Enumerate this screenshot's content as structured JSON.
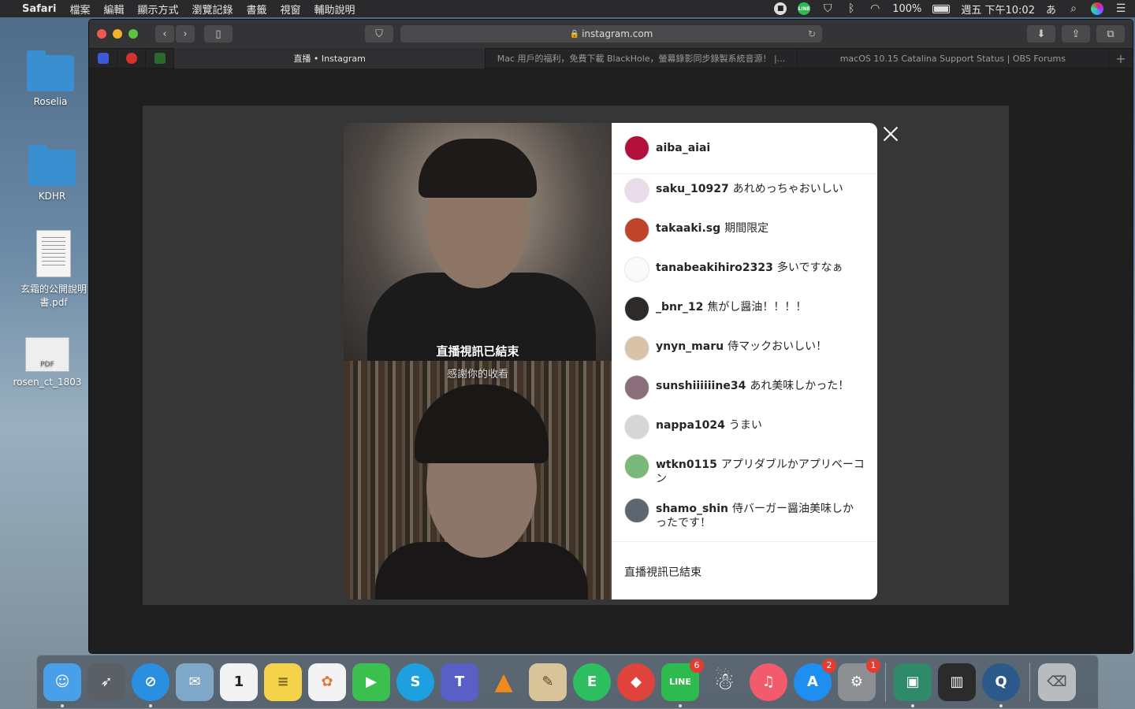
{
  "menubar": {
    "app": "Safari",
    "items": [
      "檔案",
      "編輯",
      "顯示方式",
      "瀏覽記錄",
      "書籤",
      "視窗",
      "輔助說明"
    ],
    "battery": "100%",
    "clock": "週五 下午10:02",
    "input_method": "あ",
    "line_label": "LINE"
  },
  "desktop": {
    "icons": [
      {
        "label": "Roselia"
      },
      {
        "label": "KDHR"
      },
      {
        "label": "玄霜的公開說明書.pdf"
      },
      {
        "label": "rosen_ct_1803"
      }
    ],
    "pdf_tag": "PDF"
  },
  "safari": {
    "url": "instagram.com",
    "tabs": [
      {
        "title": "直播 • Instagram",
        "active": true
      },
      {
        "title": "Mac 用戶的福利，免費下載 BlackHole，螢幕錄影同步錄製系統音源！ |...",
        "active": false
      },
      {
        "title": "macOS 10.15 Catalina Support Status | OBS Forums",
        "active": false
      }
    ]
  },
  "live": {
    "ended_title": "直播視訊已結束",
    "ended_subtitle": "感謝你的收看",
    "host": {
      "username": "aiba_aiai",
      "avatar_color": "#b0103a"
    },
    "comments": [
      {
        "user": "saku_10927",
        "text": "あれめっちゃおいしい",
        "avatar_color": "#e9dce8"
      },
      {
        "user": "takaaki.sg",
        "text": "期間限定",
        "avatar_color": "#c0442a"
      },
      {
        "user": "tanabeakihiro2323",
        "text": "多いですなぁ",
        "avatar_color": "#fafafa"
      },
      {
        "user": "_bnr_12",
        "text": "焦がし醤油！！！！",
        "avatar_color": "#2e2a2a"
      },
      {
        "user": "ynyn_maru",
        "text": "侍マックおいしい！",
        "avatar_color": "#d8c3a8"
      },
      {
        "user": "sunshiiiiiine34",
        "text": "あれ美味しかった！",
        "avatar_color": "#8a6e7a"
      },
      {
        "user": "nappa1024",
        "text": "うまい",
        "avatar_color": "#d6d6d6"
      },
      {
        "user": "wtkn0115",
        "text": "アプリダブルかアプリベーコン",
        "avatar_color": "#7ab87a"
      },
      {
        "user": "shamo_shin",
        "text": "侍バーガー醤油美味しかったです！",
        "avatar_color": "#5b6670"
      }
    ],
    "footer": "直播視訊已結束"
  },
  "dock": {
    "apps": [
      {
        "name": "finder",
        "color": "#4aa0e8",
        "glyph": "☺"
      },
      {
        "name": "launchpad",
        "color": "#5b5f66",
        "glyph": "🚀"
      },
      {
        "name": "safari",
        "color": "#2a8fe0",
        "glyph": "⊘"
      },
      {
        "name": "mail",
        "color": "#7fa8c8",
        "glyph": "✉"
      },
      {
        "name": "calendar",
        "color": "#f2f2f2",
        "glyph": "1"
      },
      {
        "name": "notes",
        "color": "#f4d34a",
        "glyph": "≡"
      },
      {
        "name": "photos",
        "color": "#f3f3f3",
        "glyph": "✿"
      },
      {
        "name": "facetime",
        "color": "#3bbf4e",
        "glyph": "▶"
      },
      {
        "name": "skype",
        "color": "#1ea0e0",
        "glyph": "S"
      },
      {
        "name": "teams",
        "color": "#5a5fc6",
        "glyph": "T"
      },
      {
        "name": "vlc",
        "color": "#f08a1a",
        "glyph": "▲"
      },
      {
        "name": "preview",
        "color": "#d9c49a",
        "glyph": "✎"
      },
      {
        "name": "evernote",
        "color": "#2dbe60",
        "glyph": "E"
      },
      {
        "name": "bear",
        "color": "#e0433c",
        "glyph": "◆"
      },
      {
        "name": "line",
        "color": "#2dba4e",
        "glyph": "LINE"
      },
      {
        "name": "qq",
        "color": "#4a4a4a",
        "glyph": "☃"
      },
      {
        "name": "music",
        "color": "#f25a6e",
        "glyph": "♫"
      },
      {
        "name": "app-store",
        "color": "#1f8ef1",
        "glyph": "A"
      },
      {
        "name": "system-preferences",
        "color": "#8c8f94",
        "glyph": "⚙"
      },
      {
        "name": "screen-sharing",
        "color": "#2f8a6a",
        "glyph": "▣"
      },
      {
        "name": "piano",
        "color": "#2b2b2b",
        "glyph": "▥"
      },
      {
        "name": "quicktime",
        "color": "#2b5a8a",
        "glyph": "Q"
      },
      {
        "name": "trash",
        "color": "#b8bcc0",
        "glyph": "🗑"
      }
    ],
    "badges": {
      "line": "6",
      "app-store": "2",
      "system-preferences": "1"
    }
  }
}
